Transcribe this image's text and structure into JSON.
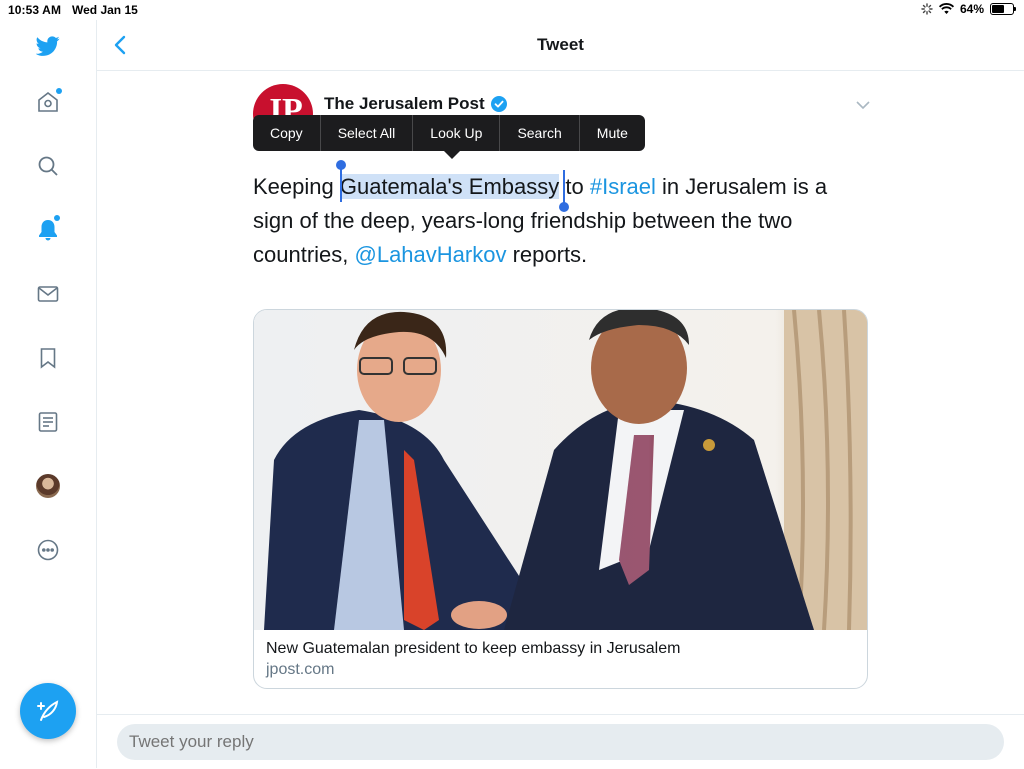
{
  "status_bar": {
    "time": "10:53 AM",
    "date": "Wed Jan 15",
    "battery": "64%",
    "battery_level": 0.64
  },
  "sidebar": {
    "items": [
      {
        "icon": "twitter-bird-icon"
      },
      {
        "icon": "home-icon"
      },
      {
        "icon": "search-icon"
      },
      {
        "icon": "notifications-bell-icon"
      },
      {
        "icon": "messages-envelope-icon"
      },
      {
        "icon": "bookmarks-icon"
      },
      {
        "icon": "lists-icon"
      },
      {
        "icon": "profile-avatar"
      },
      {
        "icon": "more-icon"
      }
    ],
    "compose_icon": "compose-feather-icon"
  },
  "header": {
    "title": "Tweet"
  },
  "tweet": {
    "author": "The Jerusalem Post",
    "avatar_text": "JP",
    "verified": true,
    "text": {
      "pre": "Keeping ",
      "selected": "Guatemala's Embassy",
      "mid": " to ",
      "hashtag": "#Israel",
      "mid2": " in Jerusalem is a sign of the deep, years-long friendship between the two countries, ",
      "mention": "@LahavHarkov",
      "post": " reports."
    },
    "card": {
      "title": "New Guatemalan president to keep embassy in Jerusalem",
      "domain": "jpost.com"
    }
  },
  "context_menu": {
    "items": [
      "Copy",
      "Select All",
      "Look Up",
      "Search",
      "Mute"
    ]
  },
  "reply": {
    "placeholder": "Tweet your reply"
  },
  "colors": {
    "accent": "#1da1f2",
    "link": "#1b95e0",
    "selection": "#cfe1f7",
    "menu_bg": "#1c1c1e"
  }
}
